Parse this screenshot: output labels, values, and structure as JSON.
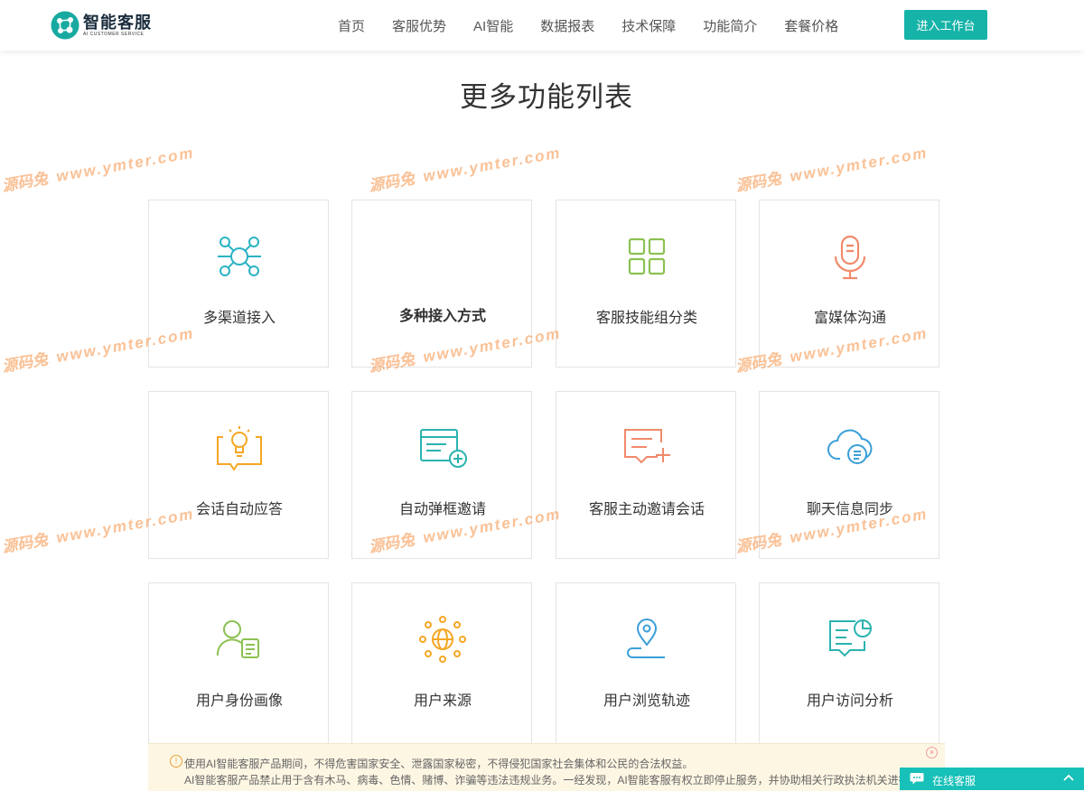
{
  "header": {
    "logo_title": "智能客服",
    "logo_subtitle": "AI CUSTOMER SERVICE",
    "nav": [
      "首页",
      "客服优势",
      "AI智能",
      "数据报表",
      "技术保障",
      "功能简介",
      "套餐价格"
    ],
    "enter_button": "进入工作台"
  },
  "section_title": "更多功能列表",
  "features": [
    {
      "label": "多渠道接入",
      "icon": "network-nodes-icon",
      "color": "#2bb3c4"
    },
    {
      "label": "多种接入方式",
      "icon": "blank",
      "color": "#333333"
    },
    {
      "label": "客服技能组分类",
      "icon": "grid-squares-icon",
      "color": "#8cc152"
    },
    {
      "label": "富媒体沟通",
      "icon": "microphone-icon",
      "color": "#f08a6b"
    },
    {
      "label": "会话自动应答",
      "icon": "lightbulb-chat-icon",
      "color": "#f5a623"
    },
    {
      "label": "自动弹框邀请",
      "icon": "browser-plus-icon",
      "color": "#2bb3b0"
    },
    {
      "label": "客服主动邀请会话",
      "icon": "chat-plus-icon",
      "color": "#f08a6b"
    },
    {
      "label": "聊天信息同步",
      "icon": "cloud-sync-icon",
      "color": "#3a9fd8"
    },
    {
      "label": "用户身份画像",
      "icon": "user-card-icon",
      "color": "#8cc152"
    },
    {
      "label": "用户来源",
      "icon": "globe-network-icon",
      "color": "#f5a623"
    },
    {
      "label": "用户浏览轨迹",
      "icon": "location-route-icon",
      "color": "#3a9fd8"
    },
    {
      "label": "用户访问分析",
      "icon": "chart-chat-icon",
      "color": "#2bb3b0"
    }
  ],
  "watermark": {
    "site": "源码兔",
    "url": "www.ymter.com"
  },
  "notice": {
    "line1": "使用AI智能客服产品期间，不得危害国家安全、泄露国家秘密，不得侵犯国家社会集体和公民的合法权益。",
    "line2": "AI智能客服产品禁止用于含有木马、病毒、色情、赌博、诈骗等违法违规业务。一经发现，AI智能客服有权立即停止服务，并协助相关行政执法机关进行"
  },
  "online_service": {
    "label": "在线客服"
  },
  "colors": {
    "accent": "#16b3a8",
    "online_bar": "#17c0b8"
  }
}
